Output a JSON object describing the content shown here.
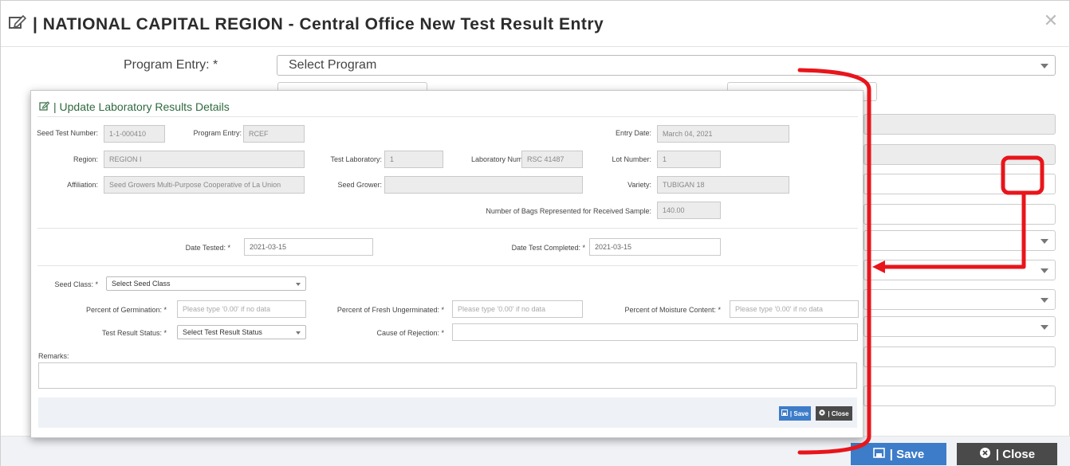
{
  "main_modal": {
    "title": "| NATIONAL CAPITAL REGION - Central Office New Test Result Entry",
    "program_label": "Program Entry: *",
    "program_value": "Select Program",
    "save_label": "| Save",
    "close_label": "| Close"
  },
  "update_modal": {
    "title": "| Update Laboratory Results Details",
    "seed_test_number_label": "Seed Test Number:",
    "seed_test_number_value": "1-1-000410",
    "program_entry_label": "Program Entry:",
    "program_entry_value": "RCEF",
    "entry_date_label": "Entry Date:",
    "entry_date_value": "March 04, 2021",
    "region_label": "Region:",
    "region_value": "REGION I",
    "test_laboratory_label": "Test Laboratory:",
    "test_laboratory_value": "1",
    "laboratory_number_label": "Laboratory Number:",
    "laboratory_number_value": "RSC 41487",
    "lot_number_label": "Lot Number:",
    "lot_number_value": "1",
    "affiliation_label": "Affiliation:",
    "affiliation_value": "Seed Growers Multi-Purpose Cooperative of La Union",
    "seed_grower_label": "Seed Grower:",
    "seed_grower_value": "",
    "variety_label": "Variety:",
    "variety_value": "TUBIGAN 18",
    "bags_label": "Number of Bags Represented for Received Sample:",
    "bags_value": "140.00",
    "date_tested_label": "Date Tested: *",
    "date_tested_value": "2021-03-15",
    "date_completed_label": "Date Test Completed: *",
    "date_completed_value": "2021-03-15",
    "seed_class_label": "Seed Class: *",
    "seed_class_value": "Select Seed Class",
    "germination_label": "Percent of Germination: *",
    "germination_placeholder": "Please type '0.00' if no data",
    "fresh_ungerminated_label": "Percent of Fresh Ungerminated: *",
    "fresh_ungerminated_placeholder": "Please type '0.00' if no data",
    "moisture_label": "Percent of Moisture Content: *",
    "moisture_placeholder": "Please type '0.00' if no data",
    "test_result_status_label": "Test Result Status: *",
    "test_result_status_value": "Select Test Result Status",
    "cause_of_rejection_label": "Cause of Rejection: *",
    "remarks_label": "Remarks:",
    "save_label": "| Save",
    "close_label": "| Close"
  },
  "colors": {
    "annotation_red": "#e8151b",
    "save_blue": "#3d7cc9",
    "close_dark": "#4a4a4a",
    "title_green": "#2e6a3f"
  }
}
